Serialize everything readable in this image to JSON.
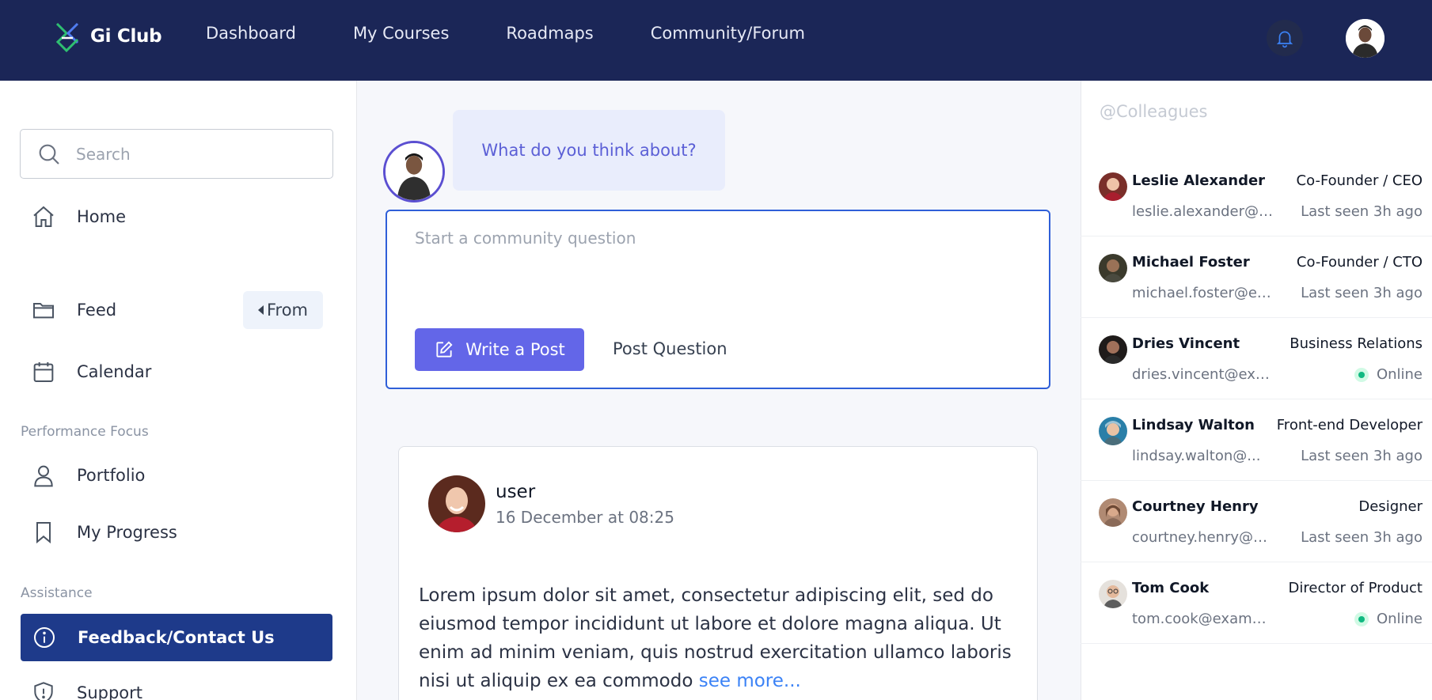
{
  "brand": {
    "name": "Gi Club"
  },
  "nav": [
    "Dashboard",
    "My Courses",
    "Roadmaps",
    "Community/Forum"
  ],
  "sidebar": {
    "search_placeholder": "Search",
    "items": [
      {
        "label": "Home",
        "icon": "home-icon"
      },
      {
        "label": "Feed",
        "icon": "folder-icon"
      },
      {
        "label": "Calendar",
        "icon": "calendar-icon"
      }
    ],
    "from_label": "From",
    "section_performance": "Performance Focus",
    "performance_items": [
      {
        "label": "Portfolio",
        "icon": "user-icon"
      },
      {
        "label": "My Progress",
        "icon": "bookmark-icon"
      }
    ],
    "section_assistance": "Assistance",
    "active_item": {
      "label": "Feedback/Contact Us",
      "icon": "info-icon"
    },
    "support_item": {
      "label": "Support",
      "icon": "shield-alert-icon"
    }
  },
  "composer": {
    "prompt": "What do you think about?",
    "placeholder": "Start a community question",
    "write_button": "Write a Post",
    "post_question": "Post Question"
  },
  "post": {
    "user": "user",
    "time": "16 December at 08:25",
    "body": "Lorem ipsum dolor sit amet, consectetur adipiscing elit, sed do eiusmod tempor incididunt ut labore et dolore magna aliqua. Ut enim ad minim veniam, quis nostrud exercitation ullamco laboris nisi ut aliquip ex ea commodo",
    "see_more": "see more..."
  },
  "colleagues": {
    "title": "@Colleagues",
    "people": [
      {
        "name": "Leslie Alexander",
        "role": "Co-Founder / CEO",
        "email": "leslie.alexander@e...",
        "status": "Last seen 3h ago",
        "online": false
      },
      {
        "name": "Michael Foster",
        "role": "Co-Founder / CTO",
        "email": "michael.foster@ex...",
        "status": "Last seen 3h ago",
        "online": false
      },
      {
        "name": "Dries Vincent",
        "role": "Business Relations",
        "email": "dries.vincent@exa...",
        "status": "Online",
        "online": true
      },
      {
        "name": "Lindsay Walton",
        "role": "Front-end Developer",
        "email": "lindsay.walton@...",
        "status": "Last seen 3h ago",
        "online": false
      },
      {
        "name": "Courtney Henry",
        "role": "Designer",
        "email": "courtney.henry@exa...",
        "status": "Last seen 3h ago",
        "online": false
      },
      {
        "name": "Tom Cook",
        "role": "Director of Product",
        "email": "tom.cook@exampl...",
        "status": "Online",
        "online": true
      }
    ]
  },
  "colors": {
    "topbar": "#1b2657",
    "accent": "#6366e8",
    "active_nav": "#1e3a8a",
    "online": "#10b981",
    "link": "#3b82f6"
  }
}
